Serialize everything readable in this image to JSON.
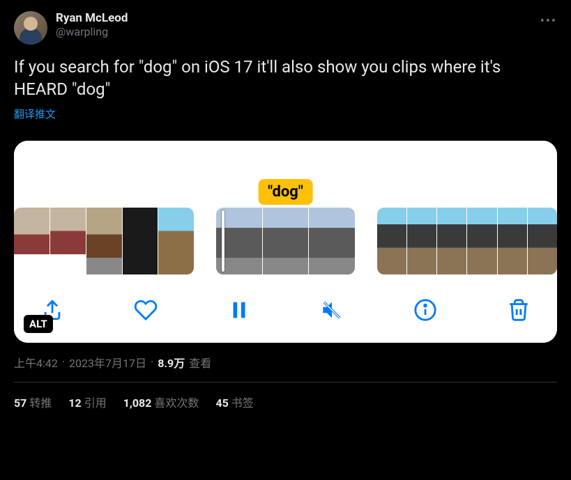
{
  "author": {
    "display_name": "Ryan McLeod",
    "handle": "@warpling"
  },
  "tweet_text": "If you search for \"dog\" on iOS 17 it'll also show you clips where it's HEARD \"dog\"",
  "translate_label": "翻译推文",
  "media": {
    "highlight_label": "\"dog\"",
    "alt_badge": "ALT"
  },
  "meta": {
    "time": "上午4:42",
    "date": "2023年7月17日",
    "views_value": "8.9万",
    "views_label": "查看",
    "separator": "·"
  },
  "stats": {
    "retweets_value": "57",
    "retweets_label": "转推",
    "quotes_value": "12",
    "quotes_label": "引用",
    "likes_value": "1,082",
    "likes_label": "喜欢次数",
    "bookmarks_value": "45",
    "bookmarks_label": "书签"
  }
}
